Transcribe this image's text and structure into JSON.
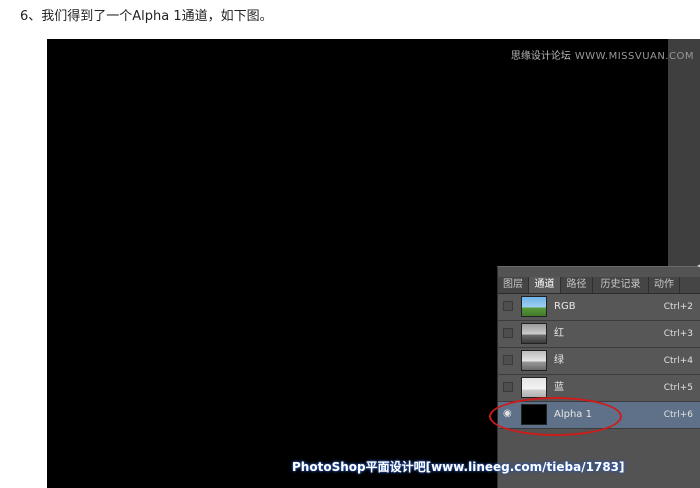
{
  "caption": "6、我们得到了一个Alpha 1通道，如下图。",
  "watermark_top": {
    "brand": "思缘设计论坛",
    "site": "WWW.MISSVUAN.COM"
  },
  "panel": {
    "tabs": [
      "图层",
      "通道",
      "路径",
      "历史记录",
      "动作"
    ],
    "active_tab": "通道",
    "channels": [
      {
        "name": "RGB",
        "shortcut": "Ctrl+2",
        "visible": false,
        "selected": false
      },
      {
        "name": "红",
        "shortcut": "Ctrl+3",
        "visible": false,
        "selected": false
      },
      {
        "name": "绿",
        "shortcut": "Ctrl+4",
        "visible": false,
        "selected": false
      },
      {
        "name": "蓝",
        "shortcut": "Ctrl+5",
        "visible": false,
        "selected": false
      },
      {
        "name": "Alpha 1",
        "shortcut": "Ctrl+6",
        "visible": true,
        "selected": true
      }
    ]
  },
  "watermark_bottom": "PhotoShop平面设计吧[www.lineeg.com/tieba/1783]",
  "colors": {
    "canvas": "#000000",
    "panel_bg": "#535353",
    "selected_row": "#5f7188",
    "annotation": "#cc1c1c"
  }
}
